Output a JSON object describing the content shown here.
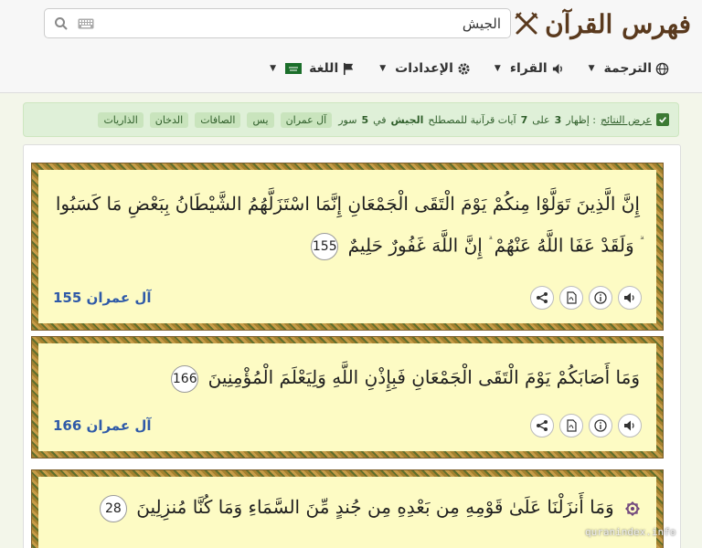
{
  "header": {
    "title": "فهرس القرآن",
    "search": {
      "value": "الجيش",
      "placeholder": ""
    },
    "nav": [
      {
        "label": "الترجمة",
        "icon": "globe-icon"
      },
      {
        "label": "القراء",
        "icon": "speaker-icon"
      },
      {
        "label": "الإعدادات",
        "icon": "gear-icon"
      },
      {
        "label": "اللغة",
        "icon": "flag-icon"
      }
    ]
  },
  "alert": {
    "label": "عرض النتائج",
    "text_a": ": إظهار",
    "shown": "3",
    "text_b": "على",
    "total": "7",
    "text_c": "آيات قرآنية للمصطلح",
    "term": "الجيش",
    "text_d": "في",
    "surah_count": "5",
    "text_e": "سور",
    "tags": [
      "آل عمران",
      "يس",
      "الصافات",
      "الدخان",
      "الذاريات"
    ]
  },
  "verses": [
    {
      "text_1": "إِنَّ الَّذِينَ تَوَلَّوْا مِنكُمْ يَوْمَ الْتَقَى الْجَمْعَانِ إِنَّمَا اسْتَزَلَّهُمُ الشَّيْطَانُ بِبَعْضِ مَا كَسَبُوا",
      "text_2": "وَلَقَدْ عَفَا اللَّهُ عَنْهُمْ",
      "text_3": "إِنَّ اللَّهَ غَفُورٌ حَلِيمٌ",
      "mark": "ۗ",
      "number": "155",
      "ref": "آل عمران 155"
    },
    {
      "text_1": "وَمَا أَصَابَكُمْ يَوْمَ الْتَقَى الْجَمْعَانِ فَبِإِذْنِ اللَّهِ وَلِيَعْلَمَ الْمُؤْمِنِينَ",
      "number": "166",
      "ref": "آل عمران 166"
    },
    {
      "text_1": "وَمَا أَنزَلْنَا عَلَىٰ قَوْمِهِ مِن بَعْدِهِ مِن جُندٍ مِّنَ السَّمَاءِ وَمَا كُنَّا مُنزِلِينَ",
      "number": "28"
    }
  ],
  "watermark": "quranindex.info",
  "colors": {
    "accent": "#2f5aa8",
    "brand": "#5a3a1e",
    "card_bg": "#fdfbc4",
    "alert_bg": "#dff0d8"
  }
}
